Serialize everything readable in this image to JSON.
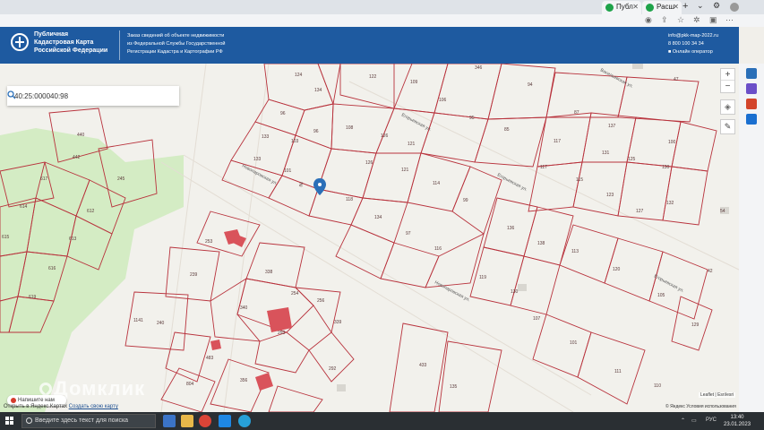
{
  "browser": {
    "tabs": [
      {
        "label": "Публ"
      },
      {
        "label": "Расш"
      }
    ]
  },
  "header": {
    "brand_lines": [
      "Публичная",
      "Кадастровая Карта",
      "Российской Федерации"
    ],
    "info_lines": [
      "Заказ сведений об объекте недвижимости",
      "из Федеральной Службы Государственной",
      "Регистрации Кадастра и Картографии РФ"
    ],
    "email": "info@pkk-map-2022.ru",
    "phone": "8 800 100 34 34",
    "operator": "Онлайн оператор"
  },
  "search": {
    "value": "40:25:000040:98"
  },
  "map": {
    "street_1": "Новопаровская ул.",
    "street_2": "Новопаровская ул.",
    "street_3": "Егорьевская ул.",
    "street_4": "Егорьевская ул.",
    "street_5": "Егорьевская ул.",
    "street_6": "Васильевская ул.",
    "lots": {
      "l124": "124",
      "l134a": "134",
      "l122": "122",
      "l109": "109",
      "l346": "346",
      "l106": "106",
      "l94": "94",
      "l95": "95",
      "l85": "85",
      "l96": "96",
      "l133": "133",
      "l103": "103",
      "l108": "108",
      "l126a": "126",
      "l121": "121",
      "l133b": "133",
      "l101": "101",
      "l126b": "126",
      "l118": "118",
      "l114": "114",
      "l99": "99",
      "l134": "134",
      "l97": "97",
      "l116": "116",
      "l440": "440",
      "l442": "442",
      "l245": "245",
      "l617": "617",
      "l614": "614",
      "l612": "612",
      "l615": "615",
      "l613": "613",
      "l616": "616",
      "l619": "619",
      "l253": "253",
      "l239": "239",
      "l338": "338",
      "l254": "254",
      "l256": "256",
      "l340": "340",
      "l293": "293",
      "l339": "339",
      "l292": "292",
      "l1141": "1141",
      "l240": "240",
      "l483": "483",
      "l804": "804",
      "l356": "356",
      "l433": "433",
      "l135": "135",
      "l47": "47",
      "l87": "87",
      "l137": "137",
      "l100": "100",
      "l117": "117",
      "l115": "115",
      "l131": "131",
      "l125": "125",
      "l130": "130",
      "l123": "123",
      "l127": "127",
      "l132": "132",
      "l136": "136",
      "l138": "138",
      "l113": "113",
      "l120": "120",
      "l105": "105",
      "l119": "119",
      "l107": "107",
      "l129": "129",
      "l101b": "101",
      "l110": "110",
      "l111": "111",
      "l42": "42",
      "l54": "54",
      "l98": "98"
    },
    "attribution": "Leaflet | Esri/esri",
    "attribution_2": "© Яндекс Условия использования",
    "chat_label": "Напишите нам",
    "ymaps_prefix": "Открыть в Яндекс.Картах",
    "ymaps_link": "Создать свою карту",
    "watermark": "Домклик"
  },
  "taskbar": {
    "search_placeholder": "Введите здесь текст для поиска",
    "tray_lang": "РУС",
    "time": "13:40",
    "date": "23.01.2023"
  },
  "colors": {
    "header_bg": "#1e5aa0",
    "parcel_stroke": "#b8323c",
    "building": "#d9535b",
    "green_area": "#d4ecc4",
    "marker": "#2a6fb8"
  }
}
